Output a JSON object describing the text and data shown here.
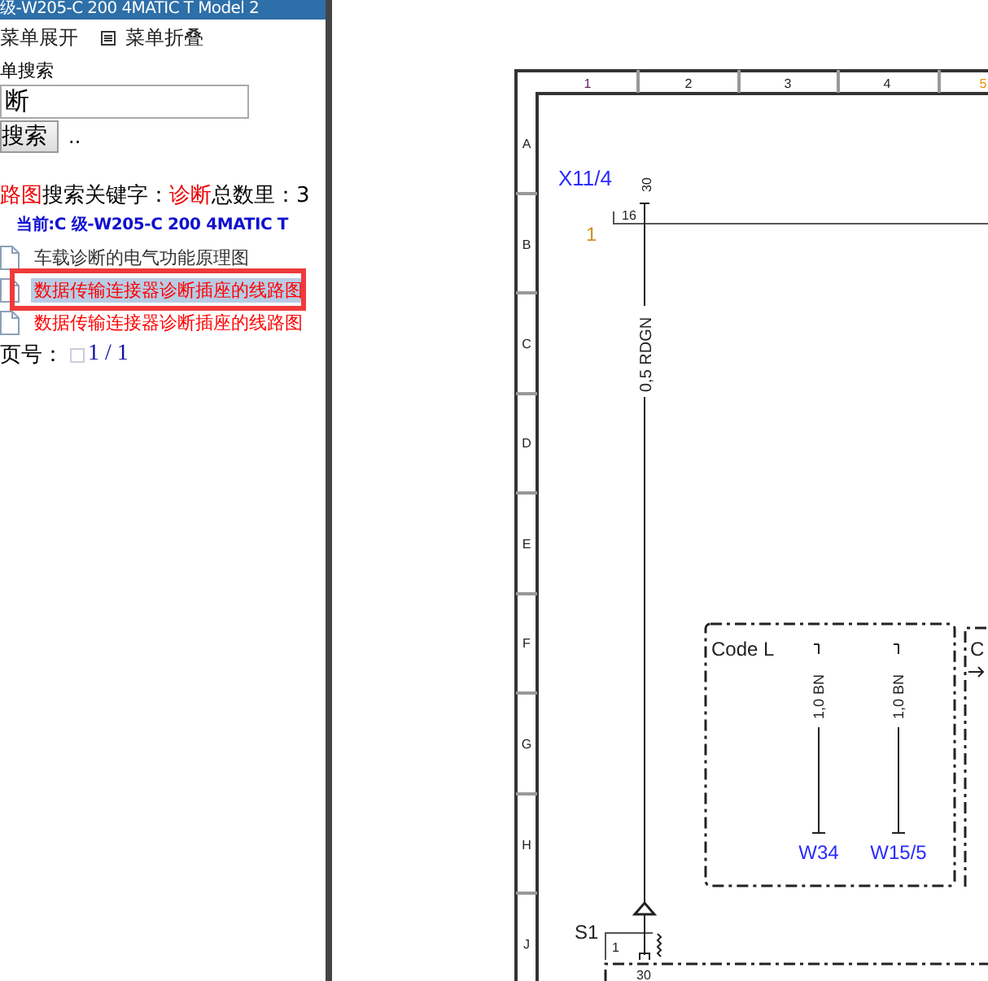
{
  "sidebar": {
    "title": "级-W205-C 200 4MATIC T Model 2",
    "menu_buttons": [
      {
        "kind": "expand",
        "label": "菜单展开"
      },
      {
        "kind": "collapse",
        "label": "菜单折叠"
      }
    ],
    "search": {
      "label": "单搜索",
      "value": "断",
      "button": "搜索",
      "extra": ".."
    },
    "result_line": [
      {
        "text": "路图",
        "kind": "keyword"
      },
      {
        "text": "搜索关键字：",
        "kind": "plain"
      },
      {
        "text": "诊断",
        "kind": "keyword"
      },
      {
        "text": "总数里：3",
        "kind": "plain"
      }
    ],
    "current": "当前:C 级-W205-C 200 4MATIC T",
    "results": [
      {
        "text": "车载诊断的电气功能原理图",
        "color": "#333333",
        "selected": false
      },
      {
        "text": "数据传输连接器诊断插座的线路图",
        "color": "#ff0000",
        "selected": true
      },
      {
        "text": "数据传输连接器诊断插座的线路图",
        "color": "#ff0000",
        "selected": false
      }
    ],
    "page": {
      "label": "页号：",
      "value": "1 / 1"
    }
  },
  "schematic": {
    "column_labels": [
      "1",
      "2",
      "3",
      "4",
      "5"
    ],
    "row_labels": [
      "A",
      "B",
      "C",
      "D",
      "E",
      "F",
      "G",
      "H",
      "J"
    ],
    "connector": "X11/4",
    "connector_pin": "30",
    "box_pin": "16",
    "branch": "1",
    "main_wire": "0,5 RDGN",
    "code_box": {
      "title": "Code L",
      "wires": [
        {
          "label": "1,0 BN",
          "end": "W34"
        },
        {
          "label": "1,0 BN",
          "end": "W15/5"
        }
      ]
    },
    "next_box": "C",
    "switch": "S1",
    "switch_pin": "1",
    "bottom_pin": "30"
  }
}
